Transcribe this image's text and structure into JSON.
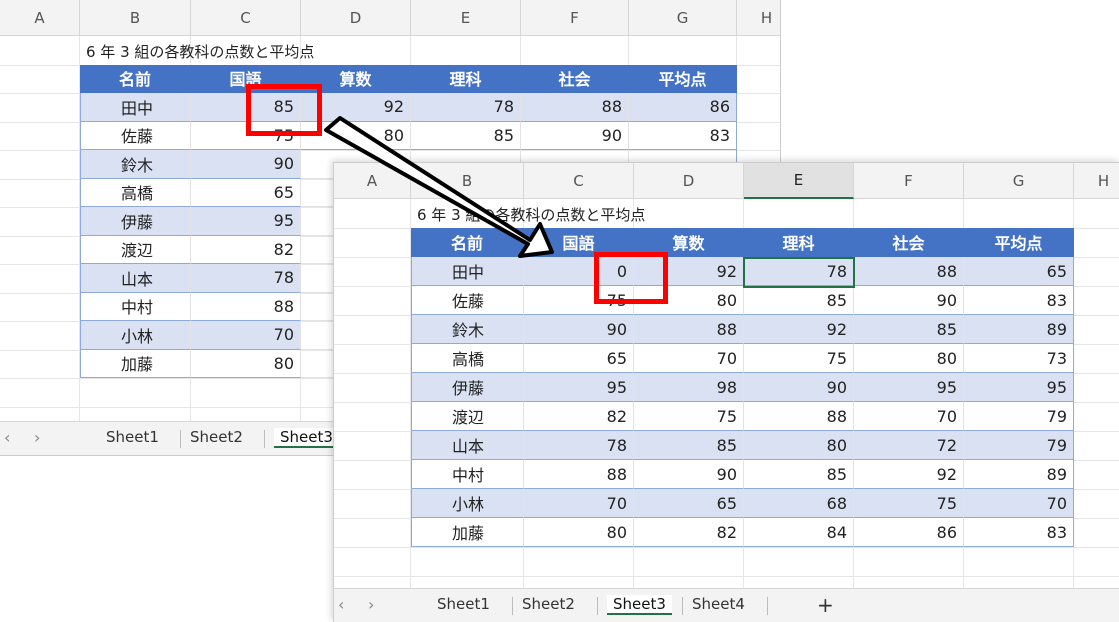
{
  "columns": [
    "A",
    "B",
    "C",
    "D",
    "E",
    "F",
    "G",
    "H"
  ],
  "title": "6 年 3 組の各教科の点数と平均点",
  "headers": [
    "名前",
    "国語",
    "算数",
    "理科",
    "社会",
    "平均点"
  ],
  "back_sheet": {
    "rows": [
      [
        "田中",
        "85",
        "92",
        "78",
        "88",
        "86"
      ],
      [
        "佐藤",
        "75",
        "80",
        "85",
        "90",
        "83"
      ],
      [
        "鈴木",
        "90",
        "",
        "",
        "",
        ""
      ],
      [
        "高橋",
        "65",
        "",
        "",
        "",
        ""
      ],
      [
        "伊藤",
        "95",
        "",
        "",
        "",
        ""
      ],
      [
        "渡辺",
        "82",
        "",
        "",
        "",
        ""
      ],
      [
        "山本",
        "78",
        "",
        "",
        "",
        ""
      ],
      [
        "中村",
        "88",
        "",
        "",
        "",
        ""
      ],
      [
        "小林",
        "70",
        "",
        "",
        "",
        ""
      ],
      [
        "加藤",
        "80",
        "",
        "",
        "",
        ""
      ]
    ],
    "tabs": [
      "Sheet1",
      "Sheet2",
      "Sheet3"
    ],
    "active_tab": "Sheet3"
  },
  "front_sheet": {
    "rows": [
      [
        "田中",
        "0",
        "92",
        "78",
        "88",
        "65"
      ],
      [
        "佐藤",
        "75",
        "80",
        "85",
        "90",
        "83"
      ],
      [
        "鈴木",
        "90",
        "88",
        "92",
        "85",
        "89"
      ],
      [
        "高橋",
        "65",
        "70",
        "75",
        "80",
        "73"
      ],
      [
        "伊藤",
        "95",
        "98",
        "90",
        "95",
        "95"
      ],
      [
        "渡辺",
        "82",
        "75",
        "88",
        "70",
        "79"
      ],
      [
        "山本",
        "78",
        "85",
        "80",
        "72",
        "79"
      ],
      [
        "中村",
        "88",
        "90",
        "85",
        "92",
        "89"
      ],
      [
        "小林",
        "70",
        "65",
        "68",
        "75",
        "70"
      ],
      [
        "加藤",
        "80",
        "82",
        "84",
        "86",
        "83"
      ]
    ],
    "tabs": [
      "Sheet1",
      "Sheet2",
      "Sheet3",
      "Sheet4"
    ],
    "active_tab": "Sheet3",
    "add_tab_label": "+",
    "selected_column": "E"
  },
  "nav": {
    "prev": "‹",
    "next": "›"
  },
  "colors": {
    "header_blue": "#4472c4",
    "band": "#d9e1f2",
    "highlight_red": "#ff0000",
    "excel_green": "#217346"
  }
}
